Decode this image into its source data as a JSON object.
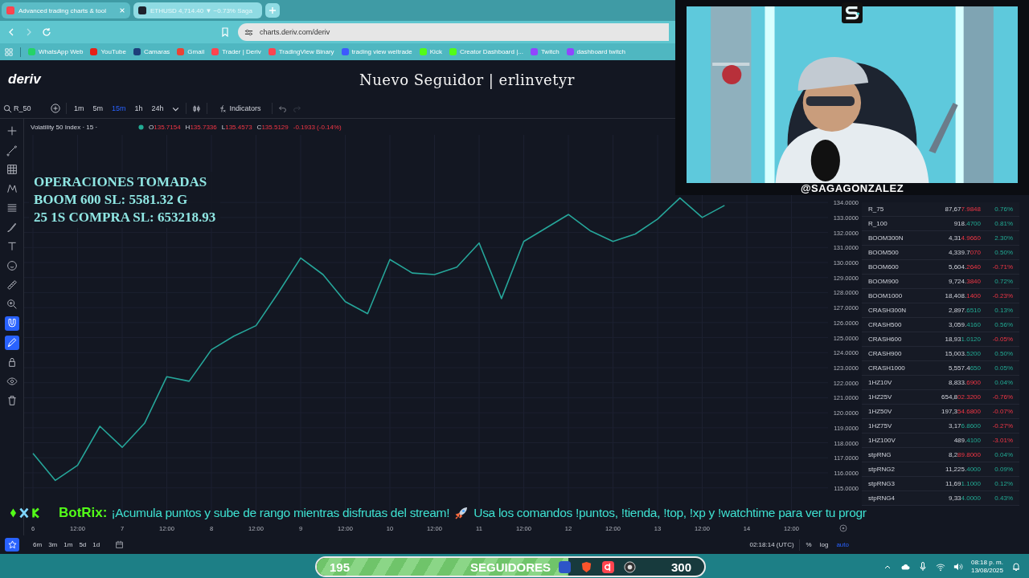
{
  "browser": {
    "tabs": [
      {
        "title": "Advanced trading charts & tool",
        "selected": true
      },
      {
        "title": "ETHUSD 4,714.40 ▼ −0.73% Saga",
        "selected": false
      }
    ],
    "address": "charts.deriv.com/deriv",
    "bookmarks": [
      {
        "label": "WhatsApp Web",
        "color": "#25d366"
      },
      {
        "label": "YouTube",
        "color": "#e62117"
      },
      {
        "label": "Camaras",
        "color": "#1d3f7a"
      },
      {
        "label": "Gmail",
        "color": "#ea4335"
      },
      {
        "label": "Trader | Deriv",
        "color": "#ff444f"
      },
      {
        "label": "TradingView Binary",
        "color": "#ff444f"
      },
      {
        "label": "trading view weltrade",
        "color": "#3d5afe"
      },
      {
        "label": "Kick",
        "color": "#53fc18"
      },
      {
        "label": "Creator Dashboard |...",
        "color": "#53fc18"
      },
      {
        "label": "Twitch",
        "color": "#9146ff"
      },
      {
        "label": "dashboard twitch",
        "color": "#9146ff"
      }
    ]
  },
  "app": {
    "logo": "deriv",
    "follower_alert": "Nuevo Seguidor | erlinvetyr",
    "symbol": "R_50",
    "intervals": [
      {
        "label": "1m",
        "selected": false
      },
      {
        "label": "5m",
        "selected": false
      },
      {
        "label": "15m",
        "selected": true
      },
      {
        "label": "1h",
        "selected": false
      },
      {
        "label": "24h",
        "selected": false
      }
    ],
    "indicators": "Indicators",
    "left_toolbar": [
      {
        "kind": "crosshair",
        "active": false
      },
      {
        "kind": "line",
        "active": false
      },
      {
        "kind": "grid",
        "active": false
      },
      {
        "kind": "pattern",
        "active": false
      },
      {
        "kind": "lines",
        "active": false
      },
      {
        "kind": "brush",
        "active": false
      },
      {
        "kind": "text",
        "active": false
      },
      {
        "kind": "emoji",
        "active": false
      },
      {
        "kind": "ruler",
        "active": false
      },
      {
        "kind": "zoom",
        "active": false
      },
      {
        "kind": "magnet",
        "active": true
      },
      {
        "kind": "pen",
        "active": true
      },
      {
        "kind": "lock",
        "active": false
      },
      {
        "kind": "eye",
        "active": false
      },
      {
        "kind": "trash",
        "active": false
      }
    ],
    "legend": {
      "title": "Volatility 50 Index · 15 ·",
      "market_open": true,
      "ohlc": [
        {
          "key": "O",
          "value": "135.7154"
        },
        {
          "key": "H",
          "value": "135.7336"
        },
        {
          "key": "L",
          "value": "135.4573"
        },
        {
          "key": "C",
          "value": "135.5129"
        }
      ],
      "change": "-0.1933 (-0.14%)"
    },
    "chart_data": {
      "type": "line",
      "categories": [
        "6",
        null,
        "12:00",
        null,
        "7",
        null,
        "12:00",
        null,
        "8",
        null,
        "12:00",
        null,
        "9",
        null,
        "12:00",
        null,
        "10",
        null,
        "12:00",
        null,
        "11",
        null,
        "12:00",
        null,
        "12",
        null,
        "12:00",
        null,
        "13",
        null,
        "12:00",
        null,
        "14",
        null,
        "12:00",
        null
      ],
      "series": [
        {
          "color": "#26a69a",
          "values": [
            117.3,
            115.5,
            116.5,
            119.1,
            117.7,
            119.3,
            122.4,
            122.1,
            124.2,
            125.1,
            125.8,
            128.0,
            130.3,
            129.2,
            127.4,
            126.6,
            130.2,
            129.3,
            129.2,
            129.7,
            131.3,
            127.6,
            131.4,
            132.3,
            133.2,
            132.1,
            131.4,
            131.9,
            132.9,
            134.3,
            133.0,
            133.8,
            null,
            null,
            null,
            null
          ]
        }
      ],
      "ylim": [
        112.9,
        138.5
      ],
      "grid": true,
      "yticks": [
        {
          "value": 115,
          "label": "115.0000"
        },
        {
          "value": 116,
          "label": "116.0000"
        },
        {
          "value": 117,
          "label": "117.0000"
        },
        {
          "value": 118,
          "label": "118.0000"
        },
        {
          "value": 119,
          "label": "119.0000"
        },
        {
          "value": 120,
          "label": "120.0000"
        },
        {
          "value": 121,
          "label": "121.0000"
        },
        {
          "value": 122,
          "label": "122.0000"
        },
        {
          "value": 123,
          "label": "123.0000"
        },
        {
          "value": 124,
          "label": "124.0000"
        },
        {
          "value": 125,
          "label": "125.0000"
        },
        {
          "value": 126,
          "label": "126.0000"
        },
        {
          "value": 127,
          "label": "127.0000"
        },
        {
          "value": 128,
          "label": "128.0000"
        },
        {
          "value": 129,
          "label": "129.0000"
        },
        {
          "value": 130,
          "label": "130.0000"
        },
        {
          "value": 131,
          "label": "131.0000"
        },
        {
          "value": 132,
          "label": "132.0000"
        },
        {
          "value": 133,
          "label": "133.0000"
        },
        {
          "value": 134,
          "label": "134.0000"
        }
      ]
    },
    "watchlist": [
      {
        "symbol": "R_75",
        "price": "87,67",
        "price_tail": "7.9848",
        "tail_up": false,
        "change": "0.76%",
        "change_up": true
      },
      {
        "symbol": "R_100",
        "price": "918.",
        "price_tail": "4700",
        "tail_up": true,
        "change": "0.81%",
        "change_up": true
      },
      {
        "symbol": "BOOM300N",
        "price": "4,31",
        "price_tail": "4.9660",
        "tail_up": false,
        "change": "2.30%",
        "change_up": true
      },
      {
        "symbol": "BOOM500",
        "price": "4,339.7",
        "price_tail": "070",
        "tail_up": false,
        "change": "0.50%",
        "change_up": true
      },
      {
        "symbol": "BOOM600",
        "price": "5,604.",
        "price_tail": "2640",
        "tail_up": false,
        "change": "-0.71%",
        "change_up": false
      },
      {
        "symbol": "BOOM900",
        "price": "9,724.",
        "price_tail": "3840",
        "tail_up": false,
        "change": "0.72%",
        "change_up": true
      },
      {
        "symbol": "BOOM1000",
        "price": "18,408.",
        "price_tail": "1400",
        "tail_up": false,
        "change": "-0.23%",
        "change_up": false
      },
      {
        "symbol": "CRASH300N",
        "price": "2,897.",
        "price_tail": "6510",
        "tail_up": true,
        "change": "0.13%",
        "change_up": true
      },
      {
        "symbol": "CRASH500",
        "price": "3,059.",
        "price_tail": "4160",
        "tail_up": true,
        "change": "0.56%",
        "change_up": true
      },
      {
        "symbol": "CRASH600",
        "price": "18,93",
        "price_tail": "1.0120",
        "tail_up": true,
        "change": "-0.05%",
        "change_up": false
      },
      {
        "symbol": "CRASH900",
        "price": "15,003.",
        "price_tail": "5200",
        "tail_up": true,
        "change": "0.50%",
        "change_up": true
      },
      {
        "symbol": "CRASH1000",
        "price": "5,557.4",
        "price_tail": "650",
        "tail_up": true,
        "change": "0.05%",
        "change_up": true
      },
      {
        "symbol": "1HZ10V",
        "price": "8,833.",
        "price_tail": "6900",
        "tail_up": false,
        "change": "0.04%",
        "change_up": true
      },
      {
        "symbol": "1HZ25V",
        "price": "654,8",
        "price_tail": "02.3200",
        "tail_up": false,
        "change": "-0.76%",
        "change_up": false
      },
      {
        "symbol": "1HZ50V",
        "price": "197,3",
        "price_tail": "54.6800",
        "tail_up": false,
        "change": "-0.07%",
        "change_up": false
      },
      {
        "symbol": "1HZ75V",
        "price": "3,17",
        "price_tail": "6.8600",
        "tail_up": true,
        "change": "-0.27%",
        "change_up": false
      },
      {
        "symbol": "1HZ100V",
        "price": "489.",
        "price_tail": "4100",
        "tail_up": true,
        "change": "-3.01%",
        "change_up": false
      },
      {
        "symbol": "stpRNG",
        "price": "8,2",
        "price_tail": "89.8000",
        "tail_up": false,
        "change": "0.04%",
        "change_up": true
      },
      {
        "symbol": "stpRNG2",
        "price": "11,225.",
        "price_tail": "4000",
        "tail_up": true,
        "change": "0.09%",
        "change_up": true
      },
      {
        "symbol": "stpRNG3",
        "price": "11,69",
        "price_tail": "1.1000",
        "tail_up": true,
        "change": "0.12%",
        "change_up": true
      },
      {
        "symbol": "stpRNG4",
        "price": "9,33",
        "price_tail": "4.0000",
        "tail_up": true,
        "change": "0.43%",
        "change_up": true
      }
    ],
    "ranges": [
      "6m",
      "3m",
      "1m",
      "5d",
      "1d"
    ],
    "clock": "02:18:14 (UTC)",
    "scale_options": [
      {
        "label": "%",
        "selected": false
      },
      {
        "label": "log",
        "selected": false
      },
      {
        "label": "auto",
        "selected": true
      }
    ]
  },
  "trades_overlay": {
    "lines": [
      "OPERACIONES TOMADAS",
      "BOOM 600 SL: 5581.32 G",
      "25 1S COMPRA SL: 653218.93"
    ]
  },
  "webcam": {
    "handle": "@SAGAGONZALEZ"
  },
  "ticker": {
    "bot": "BotRix:",
    "message_1": "¡Acumula puntos y sube de rango mientras disfrutas del stream!",
    "message_2": "Usa los comandos !puntos, !tienda, !top, !xp y !watchtime para ver tu progr"
  },
  "taskbar": {
    "followers": {
      "current": "195",
      "label": "SEGUIDORES",
      "goal": "300",
      "level": 0.65
    },
    "time": "08:18 p. m.",
    "date": "13/08/2025"
  }
}
